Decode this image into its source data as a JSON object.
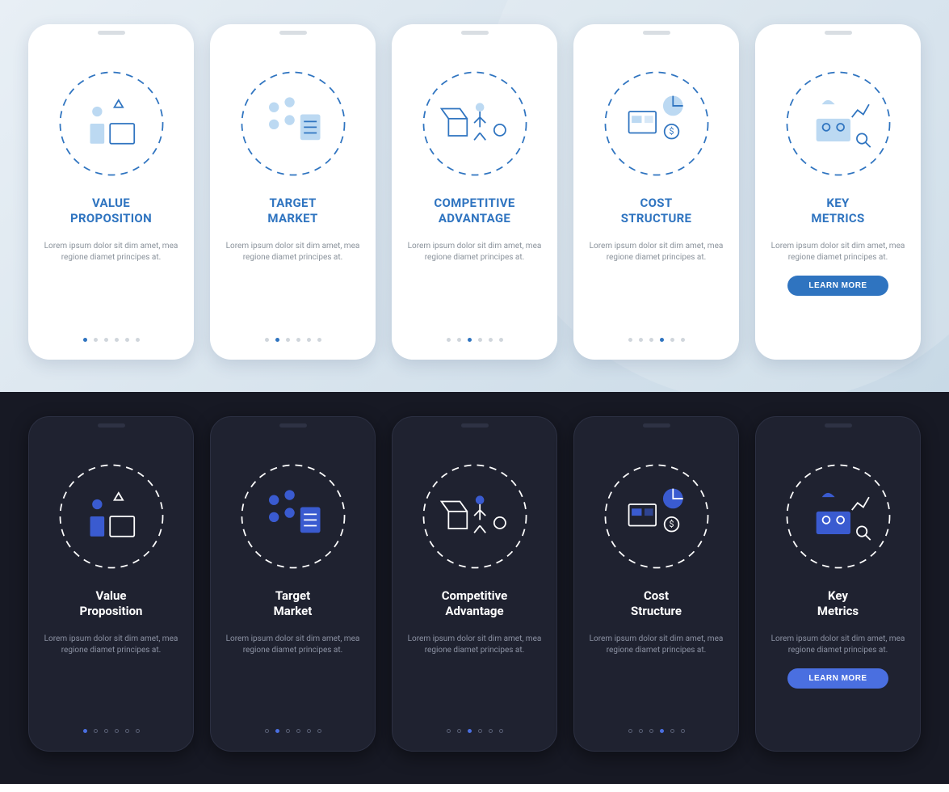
{
  "colors": {
    "accent_light": "#2f74c0",
    "accent_dark": "#4a6fe0",
    "bg_dark": "#171924",
    "card_dark": "#1f2230"
  },
  "common": {
    "description": "Lorem ipsum dolor sit dim amet, mea regione diamet principes at.",
    "cta": "LEARN MORE",
    "total_steps": 6
  },
  "cards": [
    {
      "key": "value-proposition",
      "title_light": "VALUE\nPROPOSITION",
      "title_dark": "Value\nProposition",
      "active_step": 1,
      "icon": "value-proposition-icon"
    },
    {
      "key": "target-market",
      "title_light": "TARGET\nMARKET",
      "title_dark": "Target\nMarket",
      "active_step": 2,
      "icon": "target-market-icon"
    },
    {
      "key": "competitive-advantage",
      "title_light": "COMPETITIVE\nADVANTAGE",
      "title_dark": "Competitive\nAdvantage",
      "active_step": 3,
      "icon": "competitive-advantage-icon"
    },
    {
      "key": "cost-structure",
      "title_light": "COST\nSTRUCTURE",
      "title_dark": "Cost\nStructure",
      "active_step": 4,
      "icon": "cost-structure-icon"
    },
    {
      "key": "key-metrics",
      "title_light": "KEY\nMETRICS",
      "title_dark": "Key\nMetrics",
      "active_step": 5,
      "icon": "key-metrics-icon"
    }
  ]
}
